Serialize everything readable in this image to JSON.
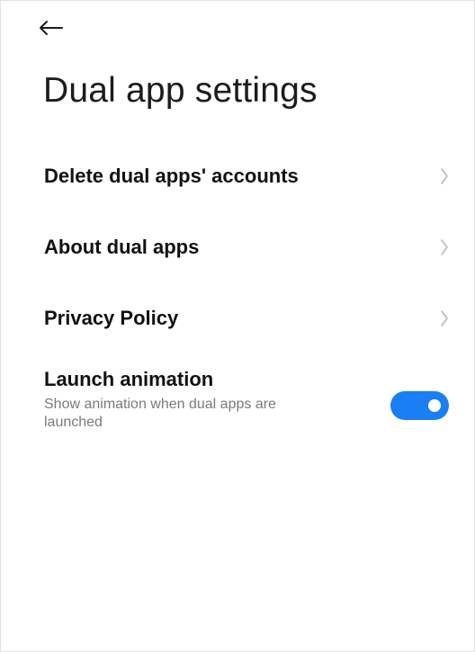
{
  "header": {
    "back_icon": "arrow-left-icon",
    "title": "Dual app settings"
  },
  "settings": {
    "items": [
      {
        "label": "Delete dual apps' accounts",
        "icon": "chevron-right-icon"
      },
      {
        "label": "About dual apps",
        "icon": "chevron-right-icon"
      },
      {
        "label": "Privacy Policy",
        "icon": "chevron-right-icon"
      }
    ],
    "launch_animation": {
      "title": "Launch animation",
      "subtitle": "Show animation when dual apps are launched",
      "enabled": true
    }
  },
  "colors": {
    "accent": "#1a7ef5",
    "chevron": "#b5b5b5",
    "subtitle_text": "#7a7a7a"
  }
}
